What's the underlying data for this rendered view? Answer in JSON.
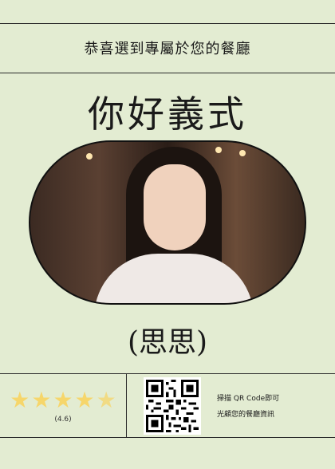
{
  "banner": {
    "text": "恭喜選到專屬於您的餐廳"
  },
  "header": {
    "title": "你好義式"
  },
  "profile": {
    "name": "(思思)"
  },
  "rating": {
    "value_text": "(4.6)",
    "stars": 4.6
  },
  "qr": {
    "instruction_line1": "掃描 QR Code即可",
    "instruction_line2": "光顧您的餐廳資訊"
  },
  "colors": {
    "background": "#e3ecd2",
    "star": "#f6d66b",
    "line": "#2b2b2b"
  }
}
